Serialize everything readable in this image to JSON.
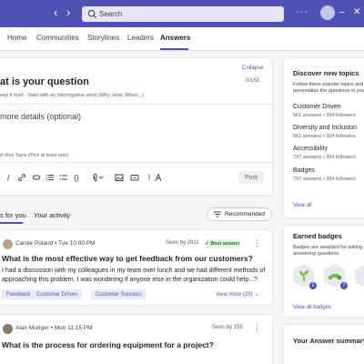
{
  "search": {
    "placeholder": "Search"
  },
  "nav": {
    "back": "‹",
    "forward": "›",
    "more": "···",
    "tabs": [
      "Home",
      "Communities",
      "Storylines",
      "Leaders",
      "Answers"
    ],
    "active": "Answers"
  },
  "window_controls": {
    "minimize": "–",
    "close": "✕"
  },
  "ask": {
    "collapse_label": "Collapse",
    "title": "at is your question",
    "counter": "0/150",
    "hint": "eep it brief · Start with an interrogative word (Why, How, When...)",
    "details_placeholder": "more details (optional)",
    "topic_hint": "d Viva Topic (Pick at least one)",
    "toolbar_glyphs": {
      "italic": "I",
      "code": "{}"
    },
    "post_label": "Post"
  },
  "feed": {
    "tabs": [
      "s for you",
      "Your activity"
    ],
    "sort_label": "Recommended",
    "posts": [
      {
        "author": "Carole Poland",
        "time": "Tue 10:00 PM",
        "seen": "Seen by 2811",
        "best_answer": "✓ Best answer",
        "title": "What is the most effective way to get feedback from our customers?",
        "body": "I had a discussion with my colleagues in my team over lunch and we had different methods of approaching this problem. I was wondering if anyone else in the organization could help...?",
        "tags": [
          "Feedback",
          "Customer Driven",
          "Customer Success"
        ],
        "view_more": "View more (25)"
      },
      {
        "author": "Alan Munger",
        "time": "Mon 11:15 PM",
        "seen": "Seen by 158",
        "title": "What is the process for ordering equipment for a project?"
      }
    ]
  },
  "discover": {
    "title": "Discover new topics",
    "desc": "Follow these popular topics and personalize the questions in your",
    "topics": [
      {
        "name": "Customer Driven",
        "stats": "561 answers • 354 followers"
      },
      {
        "name": "Diversity and Inclusion",
        "stats": "561 answers • 354 followers"
      },
      {
        "name": "Accessibility",
        "stats": "797 answers • 354 followers"
      },
      {
        "name": "Badges",
        "stats": "797 answers • 354 followers"
      }
    ],
    "view_all": "View all"
  },
  "badges": {
    "title": "Earned badges",
    "desc": "Badges are awarded for asking answering questions.",
    "counts": [
      "5",
      "7"
    ],
    "view_all": "View all badges"
  },
  "summary": {
    "title": "Your Answer summary"
  },
  "colors": {
    "brand": "#4f52b2",
    "success": "#107c10",
    "chip_bg": "#e8ebfa"
  }
}
